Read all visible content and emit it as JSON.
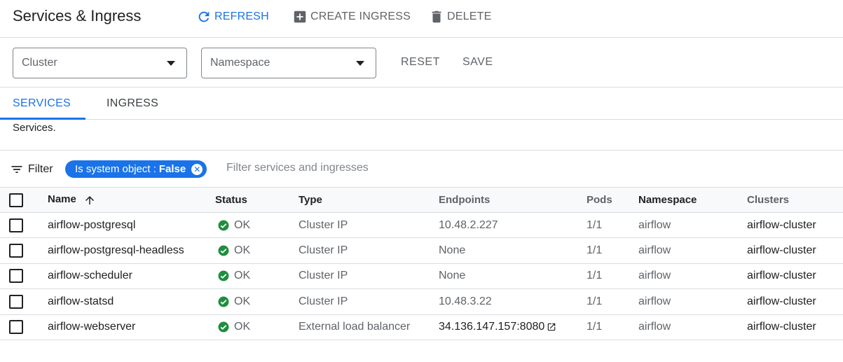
{
  "header": {
    "title": "Services & Ingress",
    "refresh_label": "REFRESH",
    "create_label": "CREATE INGRESS",
    "delete_label": "DELETE"
  },
  "filters": {
    "cluster_label": "Cluster",
    "namespace_label": "Namespace",
    "reset_label": "RESET",
    "save_label": "SAVE"
  },
  "tabs": [
    {
      "label": "SERVICES",
      "active": true
    },
    {
      "label": "INGRESS",
      "active": false
    }
  ],
  "description": "Services.",
  "table_filter": {
    "label": "Filter",
    "chip_key": "Is system object :",
    "chip_value": "False",
    "placeholder": "Filter services and ingresses"
  },
  "table": {
    "columns": [
      "Name",
      "Status",
      "Type",
      "Endpoints",
      "Pods",
      "Namespace",
      "Clusters"
    ],
    "rows": [
      {
        "name": "airflow-postgresql",
        "status": "OK",
        "type": "Cluster IP",
        "endpoints": "10.48.2.227",
        "pods": "1/1",
        "namespace": "airflow",
        "cluster": "airflow-cluster"
      },
      {
        "name": "airflow-postgresql-headless",
        "status": "OK",
        "type": "Cluster IP",
        "endpoints": "None",
        "pods": "1/1",
        "namespace": "airflow",
        "cluster": "airflow-cluster"
      },
      {
        "name": "airflow-scheduler",
        "status": "OK",
        "type": "Cluster IP",
        "endpoints": "None",
        "pods": "1/1",
        "namespace": "airflow",
        "cluster": "airflow-cluster"
      },
      {
        "name": "airflow-statsd",
        "status": "OK",
        "type": "Cluster IP",
        "endpoints": "10.48.3.22",
        "pods": "1/1",
        "namespace": "airflow",
        "cluster": "airflow-cluster"
      },
      {
        "name": "airflow-webserver",
        "status": "OK",
        "type": "External load balancer",
        "endpoints": "34.136.147.157:8080",
        "pods": "1/1",
        "namespace": "airflow",
        "cluster": "airflow-cluster"
      }
    ]
  },
  "icons": {
    "refresh": "refresh-icon",
    "create": "add-box-icon",
    "delete": "trash-icon",
    "filter": "filter-list-icon",
    "sort": "arrow-up-icon",
    "status_ok": "check-circle-icon",
    "external": "open-in-new-icon"
  },
  "colors": {
    "accent": "#1a73e8",
    "ok_green": "#1e8e3e",
    "border": "#dadce0",
    "muted_text": "#5f6368"
  }
}
